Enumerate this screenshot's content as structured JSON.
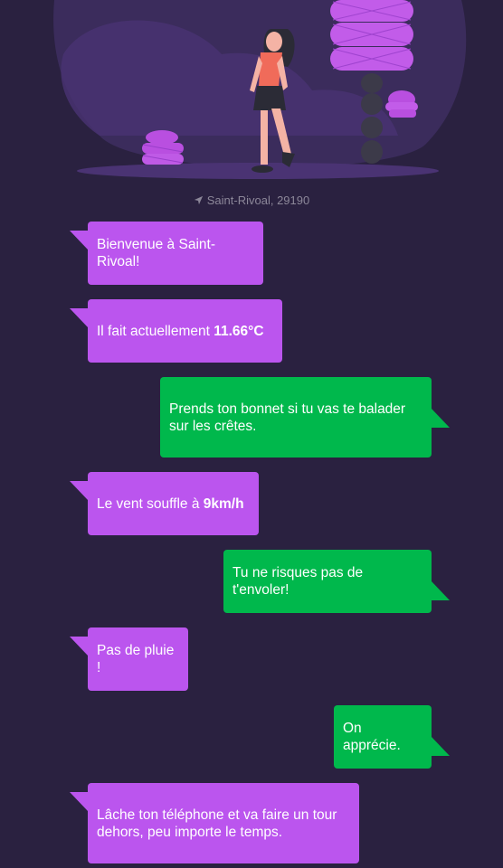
{
  "location": {
    "icon": "location-arrow-icon",
    "text": "Saint-Rivoal, 29190"
  },
  "messages": [
    {
      "from": "bot",
      "text": "Bienvenue à Saint-Rivoal!"
    },
    {
      "from": "bot",
      "text": "Il fait actuellement ",
      "value": "11.66°C"
    },
    {
      "from": "user",
      "line1": "Prends ton bonnet si tu vas te balader",
      "line2": "sur les crêtes."
    },
    {
      "from": "bot",
      "text": "Le vent souffle à ",
      "value": "9km/h"
    },
    {
      "from": "user",
      "text": "Tu ne risques pas de t'envoler!"
    },
    {
      "from": "bot",
      "text": "Pas de pluie !"
    },
    {
      "from": "user",
      "text": "On apprécie."
    },
    {
      "from": "bot",
      "line1": "Lâche ton téléphone et va faire un tour",
      "line2": "dehors, peu importe le temps."
    }
  ],
  "colors": {
    "background": "#2a2140",
    "bot_bubble": "#bb55ee",
    "user_bubble": "#00b84c",
    "location_text": "#8c8799"
  }
}
